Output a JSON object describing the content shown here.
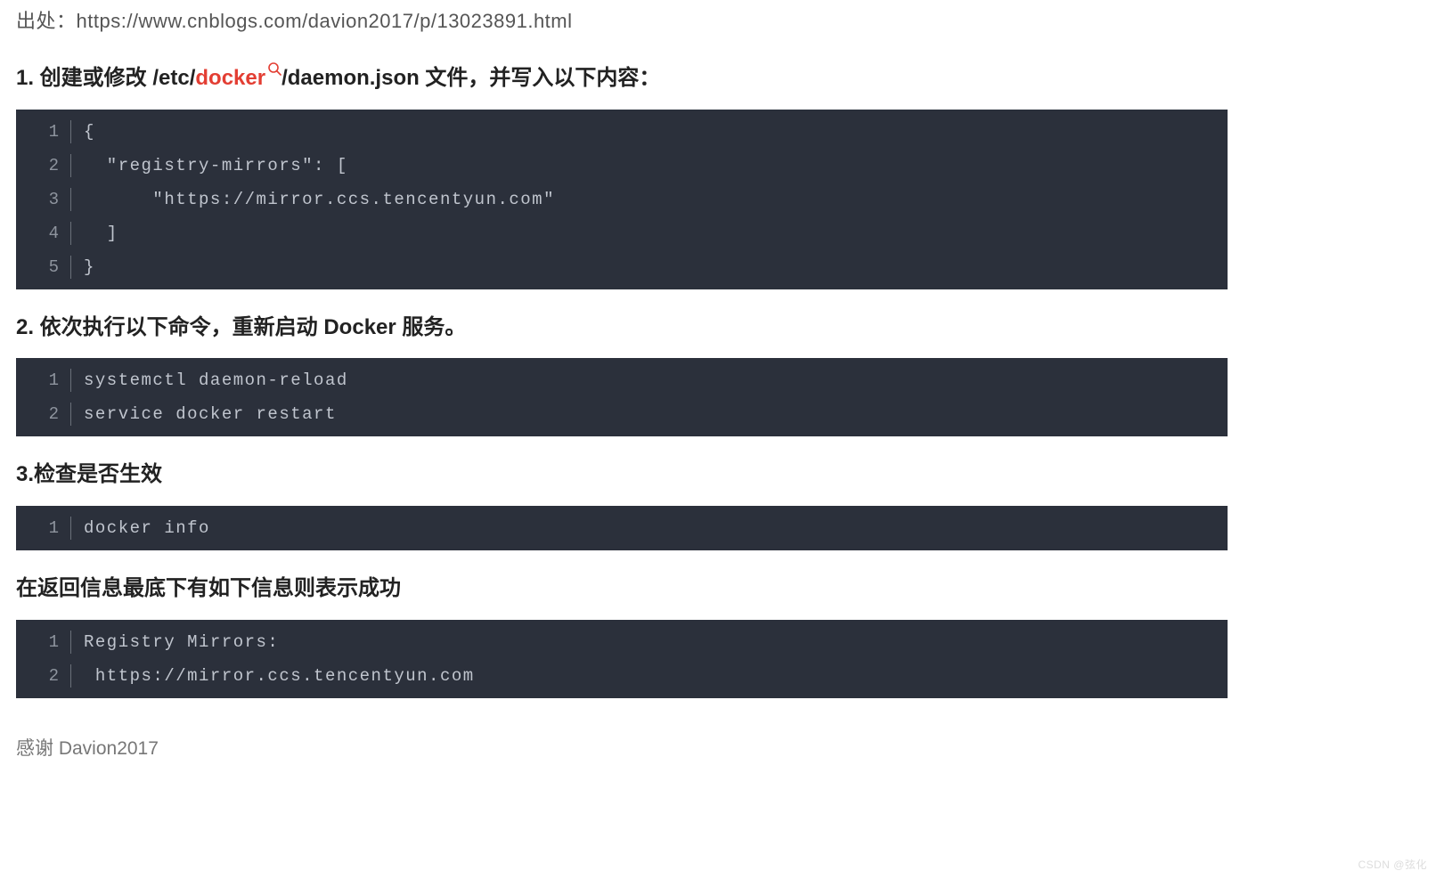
{
  "source": {
    "label": "出处：",
    "url": "https://www.cnblogs.com/davion2017/p/13023891.html"
  },
  "sections": {
    "s1": {
      "h_a": "1. 创建或修改 /etc/",
      "h_tag": "docker",
      "h_b": "/daemon.json 文件，并写入以下内容："
    },
    "s2": {
      "h": "2. 依次执行以下命令，重新启动 Docker 服务。"
    },
    "s3": {
      "h": "3.检查是否生效"
    },
    "s4": {
      "h": "在返回信息最底下有如下信息则表示成功"
    }
  },
  "code": {
    "c1": {
      "l1": "{",
      "l2": "  \"registry-mirrors\": [",
      "l3": "      \"https://mirror.ccs.tencentyun.com\"",
      "l4": "  ]",
      "l5": "}"
    },
    "c2": {
      "l1": "systemctl daemon-reload",
      "l2": "service docker restart"
    },
    "c3": {
      "l1": "docker info"
    },
    "c4": {
      "l1": "Registry Mirrors:",
      "l2": " https://mirror.ccs.tencentyun.com"
    }
  },
  "ln": {
    "1": "1",
    "2": "2",
    "3": "3",
    "4": "4",
    "5": "5"
  },
  "thanks": "感谢 Davion2017",
  "watermark": "CSDN @弦化"
}
